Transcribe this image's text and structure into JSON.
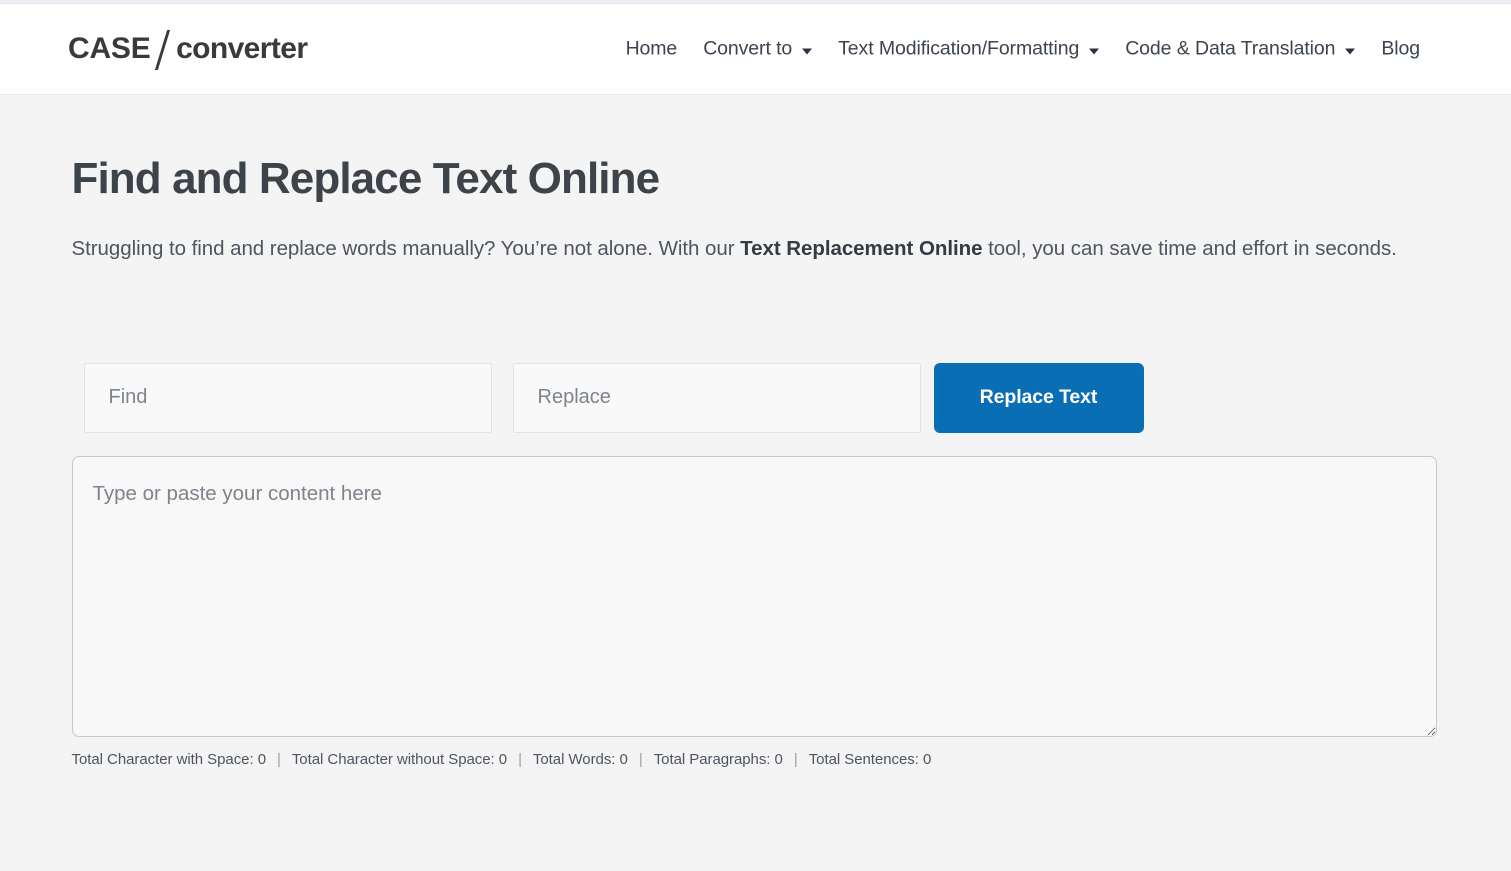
{
  "header": {
    "logo": {
      "part1": "CASE",
      "separator": "/",
      "part2": "converter"
    },
    "nav": [
      {
        "label": "Home",
        "has_caret": false
      },
      {
        "label": "Convert to",
        "has_caret": true
      },
      {
        "label": "Text Modification/Formatting",
        "has_caret": true
      },
      {
        "label": "Code & Data Translation",
        "has_caret": true
      },
      {
        "label": "Blog",
        "has_caret": false
      }
    ]
  },
  "main": {
    "title": "Find and Replace Text Online",
    "intro": {
      "before": "Struggling to find and replace words manually? You’re not alone. With our ",
      "bold": "Text Replacement Online",
      "after": " tool, you can save time and effort in seconds."
    },
    "find": {
      "value": "",
      "placeholder": "Find"
    },
    "replace": {
      "value": "",
      "placeholder": "Replace"
    },
    "replace_button": "Replace Text",
    "content": {
      "value": "",
      "placeholder": "Type or paste your content here"
    },
    "stats": [
      {
        "label": "Total Character with Space:",
        "value": "0"
      },
      {
        "label": "Total Character without Space:",
        "value": "0"
      },
      {
        "label": "Total Words:",
        "value": "0"
      },
      {
        "label": "Total Paragraphs:",
        "value": "0"
      },
      {
        "label": "Total Sentences:",
        "value": "0"
      }
    ],
    "stat_separator": "|"
  },
  "colors": {
    "accent_blue": "#0a6eb4",
    "page_background": "#f4f4f4",
    "header_background": "#ffffff",
    "heading_text": "#3d4349",
    "body_text": "#4d5560"
  }
}
